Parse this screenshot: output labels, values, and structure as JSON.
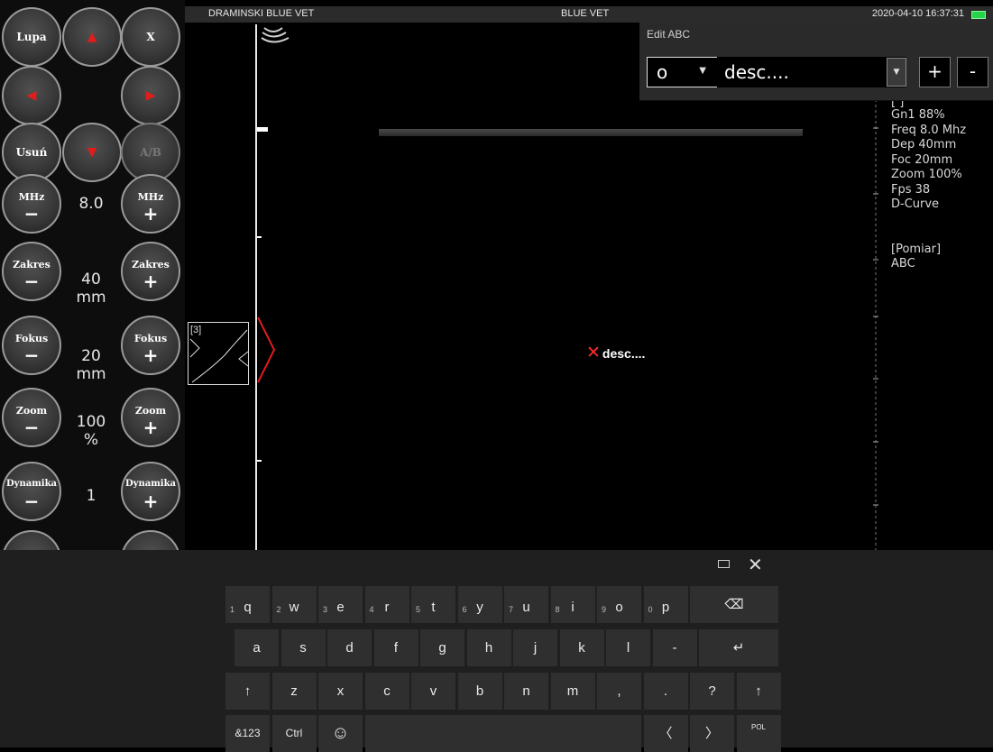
{
  "topbar": {
    "left_title": "DRAMINSKI BLUE VET",
    "center_title": "BLUE VET",
    "datetime": "2020-04-10 16:37:31"
  },
  "left_panel": {
    "lupa": "Lupa",
    "close": "X",
    "usun": "Usuń",
    "ab": "A/B",
    "mhz_label": "MHz",
    "minus": "−",
    "plus": "+",
    "mhz_value": "8.0",
    "zakres_label": "Zakres",
    "zakres_value": "40",
    "unit_mm": "mm",
    "fokus_label": "Fokus",
    "fokus_value": "20",
    "zoom_label": "Zoom",
    "zoom_value": "100",
    "unit_pct": "%",
    "dynamika_label": "Dynamika",
    "dynamika_value": "1"
  },
  "scan": {
    "curve_label": "[3]",
    "marker_label": "desc...."
  },
  "edit_dialog": {
    "title": "Edit ABC",
    "select_value": "o",
    "desc_value": "desc....",
    "add": "+",
    "remove": "-"
  },
  "info": {
    "header": "[    ]",
    "lines": [
      "Gn1 88%",
      "Freq 8.0 Mhz",
      "Dep 40mm",
      "Foc 20mm",
      "Zoom 100%",
      "Fps 38",
      "D-Curve"
    ],
    "pomiar": "[Pomiar]",
    "abc": "ABC"
  },
  "keyboard": {
    "row1": [
      {
        "k": "q",
        "n": "1"
      },
      {
        "k": "w",
        "n": "2"
      },
      {
        "k": "e",
        "n": "3"
      },
      {
        "k": "r",
        "n": "4"
      },
      {
        "k": "t",
        "n": "5"
      },
      {
        "k": "y",
        "n": "6"
      },
      {
        "k": "u",
        "n": "7"
      },
      {
        "k": "i",
        "n": "8"
      },
      {
        "k": "o",
        "n": "9"
      },
      {
        "k": "p",
        "n": "0"
      }
    ],
    "row2": [
      "a",
      "s",
      "d",
      "f",
      "g",
      "h",
      "j",
      "k",
      "l",
      "-"
    ],
    "row3": [
      "z",
      "x",
      "c",
      "v",
      "b",
      "n",
      "m",
      ",",
      ".",
      "?"
    ],
    "backspace": "⌫",
    "enter": "↵",
    "shift": "↑",
    "sym": "&123",
    "ctrl": "Ctrl",
    "emoji": "☺",
    "left": "〈",
    "right": "〉",
    "lang": "POL",
    "close": "✕"
  }
}
